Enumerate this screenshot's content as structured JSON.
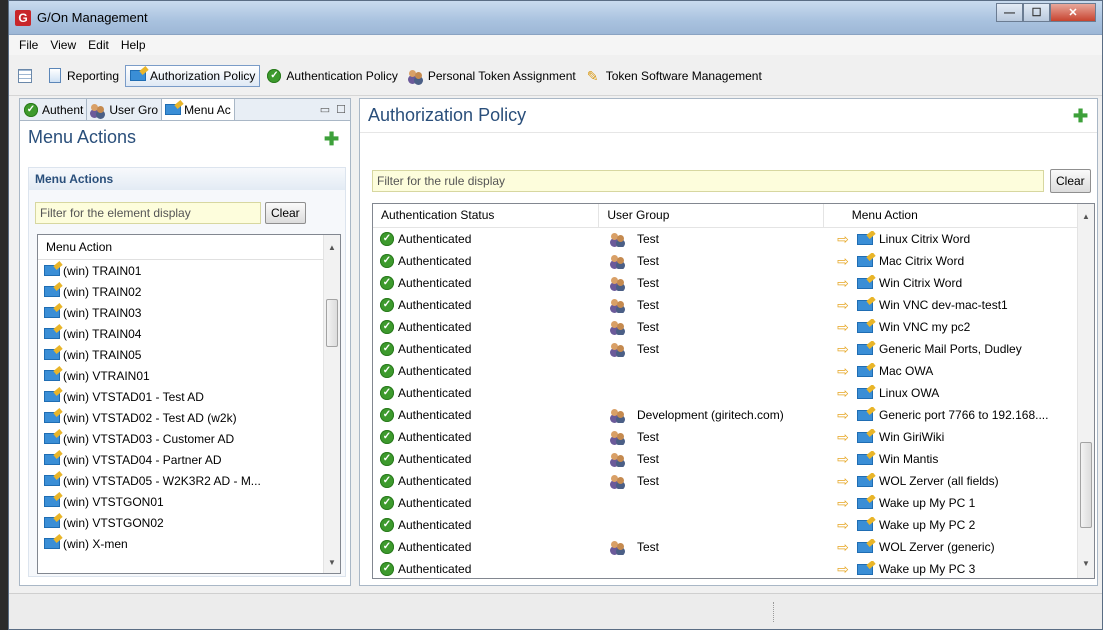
{
  "window": {
    "title": "G/On Management",
    "app_icon_letter": "G",
    "min": "—",
    "max": "☐",
    "close": "✕"
  },
  "menu": [
    "File",
    "View",
    "Edit",
    "Help"
  ],
  "toolbar": {
    "items": [
      {
        "label": "Reporting",
        "icon": "report-icon"
      },
      {
        "label": "Authorization Policy",
        "icon": "edit-icon",
        "active": true
      },
      {
        "label": "Authentication Policy",
        "icon": "check-icon"
      },
      {
        "label": "Personal Token Assignment",
        "icon": "users-icon"
      },
      {
        "label": "Token Software Management",
        "icon": "token-icon"
      }
    ]
  },
  "left": {
    "tabs": [
      "Authent",
      "User Gro",
      "Menu Ac"
    ],
    "header": "Menu Actions",
    "section_title": "Menu Actions",
    "filter_placeholder": "Filter for the element display",
    "clear_label": "Clear",
    "column": "Menu Action",
    "items": [
      "(win) TRAIN01",
      "(win) TRAIN02",
      "(win) TRAIN03",
      "(win) TRAIN04",
      "(win) TRAIN05",
      "(win) VTRAIN01",
      "(win) VTSTAD01 - Test AD",
      "(win) VTSTAD02 - Test AD (w2k)",
      "(win) VTSTAD03 - Customer AD",
      "(win) VTSTAD04 - Partner AD",
      "(win) VTSTAD05 - W2K3R2 AD - M...",
      "(win) VTSTGON01",
      "(win) VTSTGON02",
      "(win) X-men"
    ]
  },
  "right": {
    "header": "Authorization Policy",
    "filter_placeholder": "Filter for the rule display",
    "clear_label": "Clear",
    "columns": [
      "Authentication Status",
      "User Group",
      "Menu Action"
    ],
    "rows": [
      {
        "status": "Authenticated",
        "group": "Test",
        "action": "Linux Citrix Word"
      },
      {
        "status": "Authenticated",
        "group": "Test",
        "action": "Mac Citrix Word"
      },
      {
        "status": "Authenticated",
        "group": "Test",
        "action": "Win Citrix Word"
      },
      {
        "status": "Authenticated",
        "group": "Test",
        "action": "Win VNC dev-mac-test1"
      },
      {
        "status": "Authenticated",
        "group": "Test",
        "action": "Win VNC my pc2"
      },
      {
        "status": "Authenticated",
        "group": "Test",
        "action": "Generic Mail Ports, Dudley"
      },
      {
        "status": "Authenticated",
        "group": "",
        "action": "Mac OWA"
      },
      {
        "status": "Authenticated",
        "group": "",
        "action": "Linux OWA"
      },
      {
        "status": "Authenticated",
        "group": "Development (giritech.com)",
        "action": "Generic port 7766 to 192.168...."
      },
      {
        "status": "Authenticated",
        "group": "Test",
        "action": "Win GiriWiki"
      },
      {
        "status": "Authenticated",
        "group": "Test",
        "action": "Win Mantis"
      },
      {
        "status": "Authenticated",
        "group": "Test",
        "action": "WOL Zerver (all fields)"
      },
      {
        "status": "Authenticated",
        "group": "",
        "action": "Wake up My PC 1"
      },
      {
        "status": "Authenticated",
        "group": "",
        "action": "Wake up My PC 2"
      },
      {
        "status": "Authenticated",
        "group": "Test",
        "action": "WOL Zerver (generic)"
      },
      {
        "status": "Authenticated",
        "group": "",
        "action": "Wake up My PC 3"
      }
    ]
  },
  "colors": {
    "accent": "#2a4f7b",
    "check": "#3d9a2d",
    "filter_bg": "#fdfddc",
    "add": "#3da03a"
  }
}
